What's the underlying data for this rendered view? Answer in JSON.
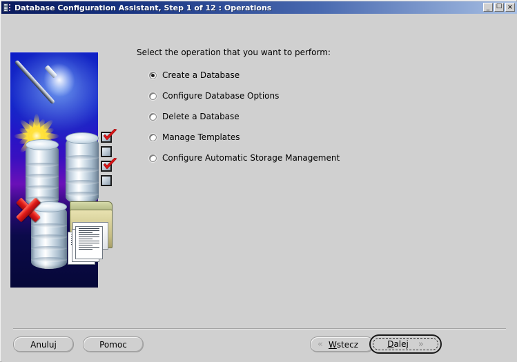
{
  "window": {
    "title": "Database Configuration Assistant, Step 1 of 12 : Operations",
    "icon": "database-server-icon",
    "background_color": "#d0d0d0",
    "titlebar_gradient_from": "#0a1a5c",
    "titlebar_gradient_to": "#a8c0e4",
    "controls": {
      "minimize": "_",
      "maximize": "□",
      "close": "×"
    }
  },
  "illustration": {
    "name": "database-wizard-illustration",
    "elements": [
      "magic-wand-icon",
      "sparkle-star-icon",
      "database-cylinder-icon",
      "checklist-icon",
      "red-x-icon",
      "folder-documents-icon"
    ],
    "background_colors": [
      "#0a18c8",
      "#6a10b8",
      "#060838"
    ],
    "accent_color": "#ffe23c",
    "delete_color": "#e01b18"
  },
  "main": {
    "prompt": "Select the operation that you want to perform:",
    "options": [
      {
        "label": "Create a Database",
        "selected": true
      },
      {
        "label": "Configure Database Options",
        "selected": false
      },
      {
        "label": "Delete a Database",
        "selected": false
      },
      {
        "label": "Manage Templates",
        "selected": false
      },
      {
        "label": "Configure Automatic Storage Management",
        "selected": false
      }
    ]
  },
  "footer": {
    "cancel_label": "Anuluj",
    "help_label": "Pomoc",
    "back": {
      "mnemonic": "W",
      "rest": "stecz",
      "chevron": "«",
      "enabled": false
    },
    "next": {
      "mnemonic": "D",
      "rest": "alej",
      "chevron": "»",
      "default": true,
      "focused": true
    }
  }
}
